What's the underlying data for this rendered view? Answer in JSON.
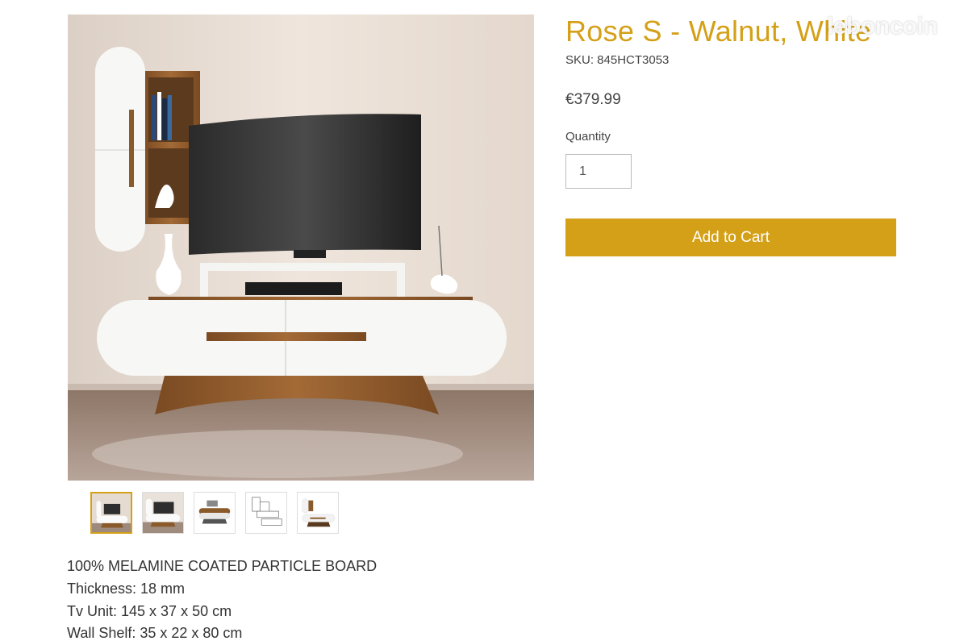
{
  "product": {
    "title": "Rose S - Walnut, White",
    "sku": "SKU: 845HCT3053",
    "price": "€379.99",
    "quantity_label": "Quantity",
    "quantity_value": "1",
    "add_to_cart_label": "Add to Cart"
  },
  "description": [
    "100% MELAMINE COATED PARTICLE BOARD",
    "Thickness: 18 mm",
    "Tv Unit: 145 x 37 x 50 cm",
    "Wall Shelf: 35 x 22 x 80 cm"
  ],
  "gallery": {
    "thumbnail_count": 5,
    "active_index": 0
  },
  "watermark": "leboncoin",
  "colors": {
    "accent": "#d4a017",
    "walnut": "#8a5a2b",
    "white_panel": "#f7f7f5"
  }
}
